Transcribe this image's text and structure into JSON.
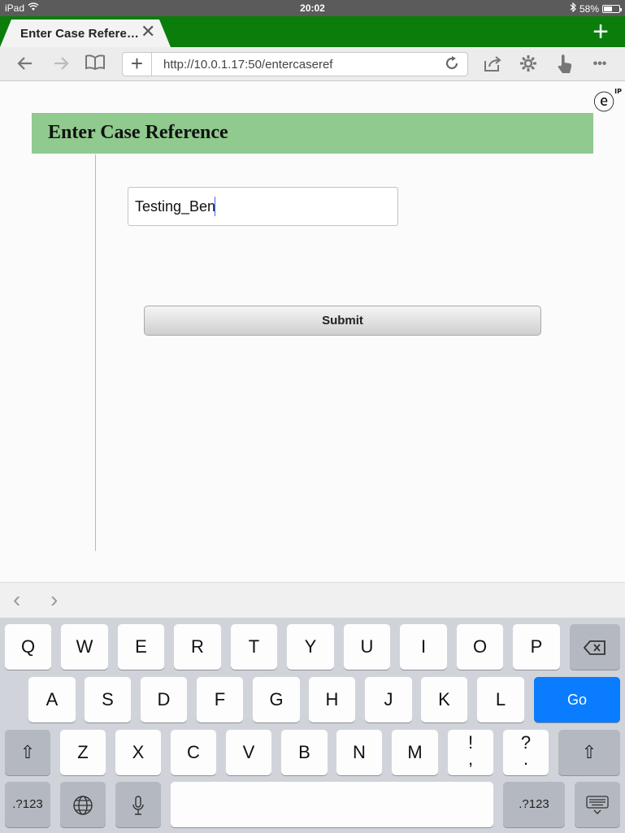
{
  "status_bar": {
    "device": "iPad",
    "wifi_icon": "wifi-icon",
    "time": "20:02",
    "bluetooth_icon": "bluetooth-icon",
    "battery_text": "58%",
    "battery_level": 0.58
  },
  "tabs": [
    {
      "title": "Enter Case Refere…",
      "close_label": "✕"
    }
  ],
  "tab_strip": {
    "new_tab_label": "+",
    "accent": "#0b7d0b"
  },
  "toolbar": {
    "back": "←",
    "forward": "→",
    "bookmarks": "📖",
    "url_plus": "+",
    "url": "http://10.0.1.17:50/entercaseref",
    "reload": "↻",
    "share": "⇪",
    "settings": "⚙",
    "pointer": "☝",
    "more": "•••"
  },
  "page": {
    "logo_letter": "ⓔ",
    "logo_sup": "IP",
    "title": "Enter Case Reference",
    "header_color": "#90ca8e",
    "case_ref_value": "Testing_Ben",
    "submit_label": "Submit"
  },
  "assist_bar": {
    "prev": "‹",
    "next": "›"
  },
  "keyboard": {
    "row1": [
      "Q",
      "W",
      "E",
      "R",
      "T",
      "Y",
      "U",
      "I",
      "O",
      "P"
    ],
    "backspace": "⌫",
    "row2": [
      "A",
      "S",
      "D",
      "F",
      "G",
      "H",
      "J",
      "K",
      "L"
    ],
    "go": "Go",
    "row3": [
      "Z",
      "X",
      "C",
      "V",
      "B",
      "N",
      "M"
    ],
    "excl_top": "!",
    "excl_bottom": ",",
    "q_top": "?",
    "q_bottom": ".",
    "shift": "⇧",
    "numbers": ".?123",
    "globe": "🌐",
    "mic": "🎙",
    "hide": "⌨"
  }
}
